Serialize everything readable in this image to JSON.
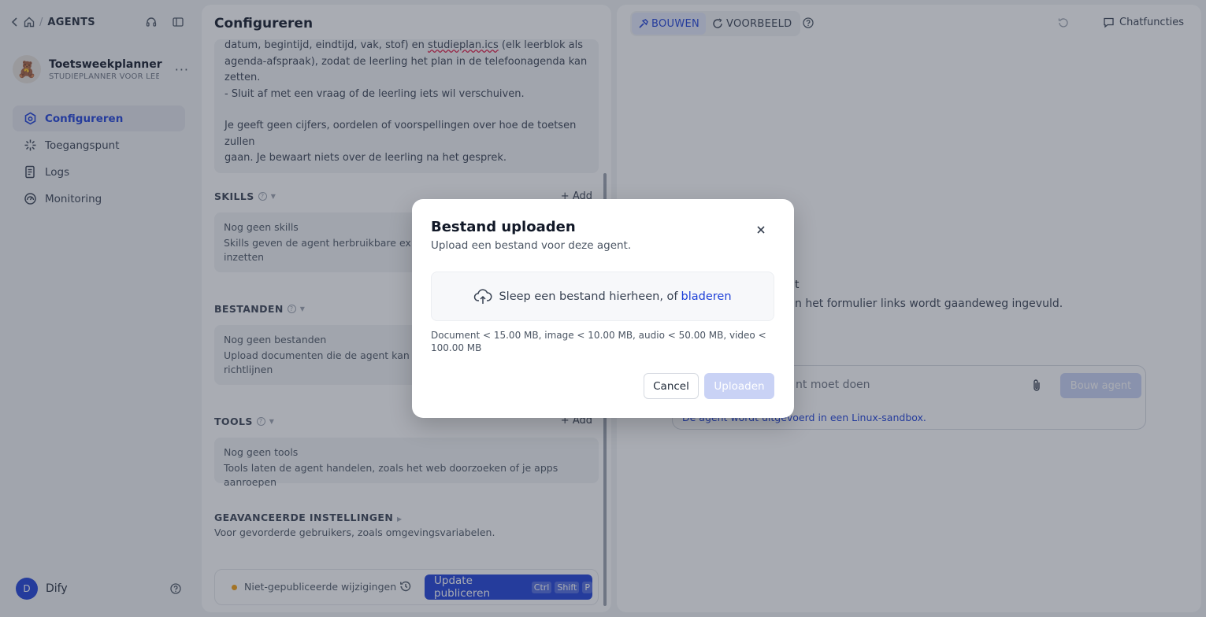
{
  "breadcrumb": {
    "section": "AGENTS"
  },
  "agent": {
    "name": "Toetsweekplanner",
    "subtitle": "STUDIEPLANNER VOOR LEE...",
    "avatar_emoji": "🧸"
  },
  "sidebar": {
    "items": [
      {
        "label": "Configureren",
        "icon": "config-icon"
      },
      {
        "label": "Toegangspunt",
        "icon": "entrypoint-icon"
      },
      {
        "label": "Logs",
        "icon": "logs-icon"
      },
      {
        "label": "Monitoring",
        "icon": "monitoring-icon"
      }
    ]
  },
  "user": {
    "initial": "D",
    "name": "Dify"
  },
  "config": {
    "title": "Configureren",
    "instructions": {
      "line1_pre": "datum, begintijd, eindtijd, vak, stof) en ",
      "line1_ul": "studieplan.ics",
      "line1_post": " (elk leerblok als",
      "line2": "agenda-afspraak), zodat de leerling het plan in de telefoonagenda kan",
      "line3": "zetten.",
      "line4": "- Sluit af met een vraag of de leerling iets wil verschuiven.",
      "line5": "Je geeft geen cijfers, oordelen of voorspellingen over hoe de toetsen zullen",
      "line6": "gaan. Je bewaart niets over de leerling na het gesprek."
    },
    "skills": {
      "title": "SKILLS",
      "add": "Add",
      "empty_title": "Nog geen skills",
      "empty_line1": "Skills geven de agent herbruikbare expert",
      "empty_line2": "inzetten"
    },
    "files": {
      "title": "BESTANDEN",
      "empty_title": "Nog geen bestanden",
      "empty_line1": "Upload documenten die de agent kan leze",
      "empty_line2": "richtlijnen"
    },
    "tools": {
      "title": "TOOLS",
      "add": "Add",
      "empty_title": "Nog geen tools",
      "empty_desc": "Tools laten de agent handelen, zoals het web doorzoeken of je apps aanroepen"
    },
    "advanced": {
      "title": "GEAVANCEERDE INSTELLINGEN",
      "desc": "Voor gevorderde gebruikers, zoals omgevingsvariabelen."
    },
    "publish": {
      "status": "Niet-gepubliceerde wijzigingen ·",
      "button": "Update publiceren",
      "kbd1": "Ctrl",
      "kbd2": "Shift",
      "kbd3": "P"
    }
  },
  "preview": {
    "tabs": [
      {
        "label": "BOUWEN"
      },
      {
        "label": "VOORBEELD"
      }
    ],
    "chat_functions": "Chatfuncties",
    "hint1": "t",
    "hint2": "n het formulier links wordt gaandeweg ingevuld.",
    "composer_placeholder": "nt moet doen",
    "send_label": "Bouw agent",
    "sandbox": "De agent wordt uitgevoerd in een Linux-sandbox."
  },
  "modal": {
    "title": "Bestand uploaden",
    "subtitle": "Upload een bestand voor deze agent.",
    "drop_text": "Sleep een bestand hierheen, of",
    "browse_link": "bladeren",
    "limits": "Document < 15.00 MB, image < 10.00 MB, audio < 50.00 MB, video < 100.00 MB",
    "cancel": "Cancel",
    "upload": "Uploaden"
  },
  "colors": {
    "accent": "#1d3fd8",
    "status_dot": "#f59e0b",
    "warning_underline": "#e11d48"
  }
}
